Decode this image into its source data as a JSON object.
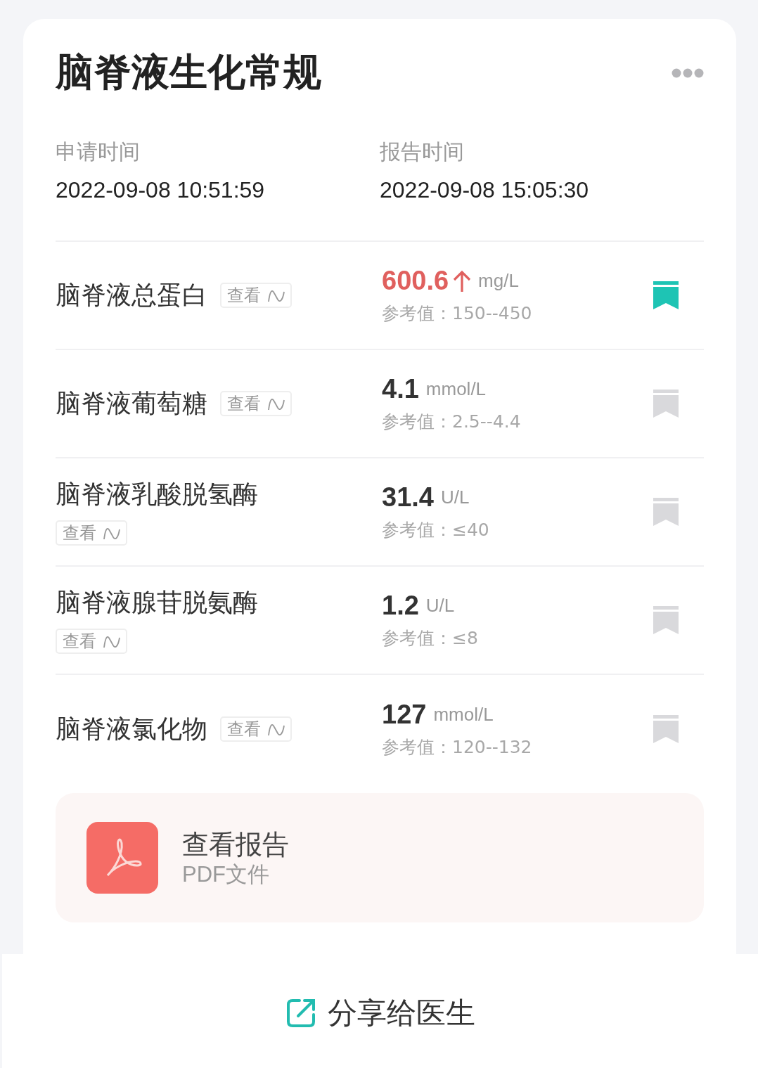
{
  "title": "脑脊液生化常规",
  "times": [
    {
      "label": "申请时间",
      "value": "2022-09-08 10:51:59"
    },
    {
      "label": "报告时间",
      "value": "2022-09-08 15:05:30"
    }
  ],
  "items": [
    {
      "name": "脑脊液总蛋白",
      "view": "查看",
      "value": "600.6",
      "high": true,
      "unit": "mg/L",
      "reference": "参考值：150--450",
      "bookmarked": true
    },
    {
      "name": "脑脊液葡萄糖",
      "view": "查看",
      "value": "4.1",
      "high": false,
      "unit": "mmol/L",
      "reference": "参考值：2.5--4.4",
      "bookmarked": false
    },
    {
      "name": "脑脊液乳酸脱氢酶",
      "view": "查看",
      "value": "31.4",
      "high": false,
      "unit": "U/L",
      "reference": "参考值：≤40",
      "bookmarked": false
    },
    {
      "name": "脑脊液腺苷脱氨酶",
      "view": "查看",
      "value": "1.2",
      "high": false,
      "unit": "U/L",
      "reference": "参考值：≤8",
      "bookmarked": false
    },
    {
      "name": "脑脊液氯化物",
      "view": "查看",
      "value": "127",
      "high": false,
      "unit": "mmol/L",
      "reference": "参考值：120--132",
      "bookmarked": false
    }
  ],
  "report": {
    "title": "查看报告",
    "subtitle": "PDF文件"
  },
  "share_button": "分享给医生"
}
